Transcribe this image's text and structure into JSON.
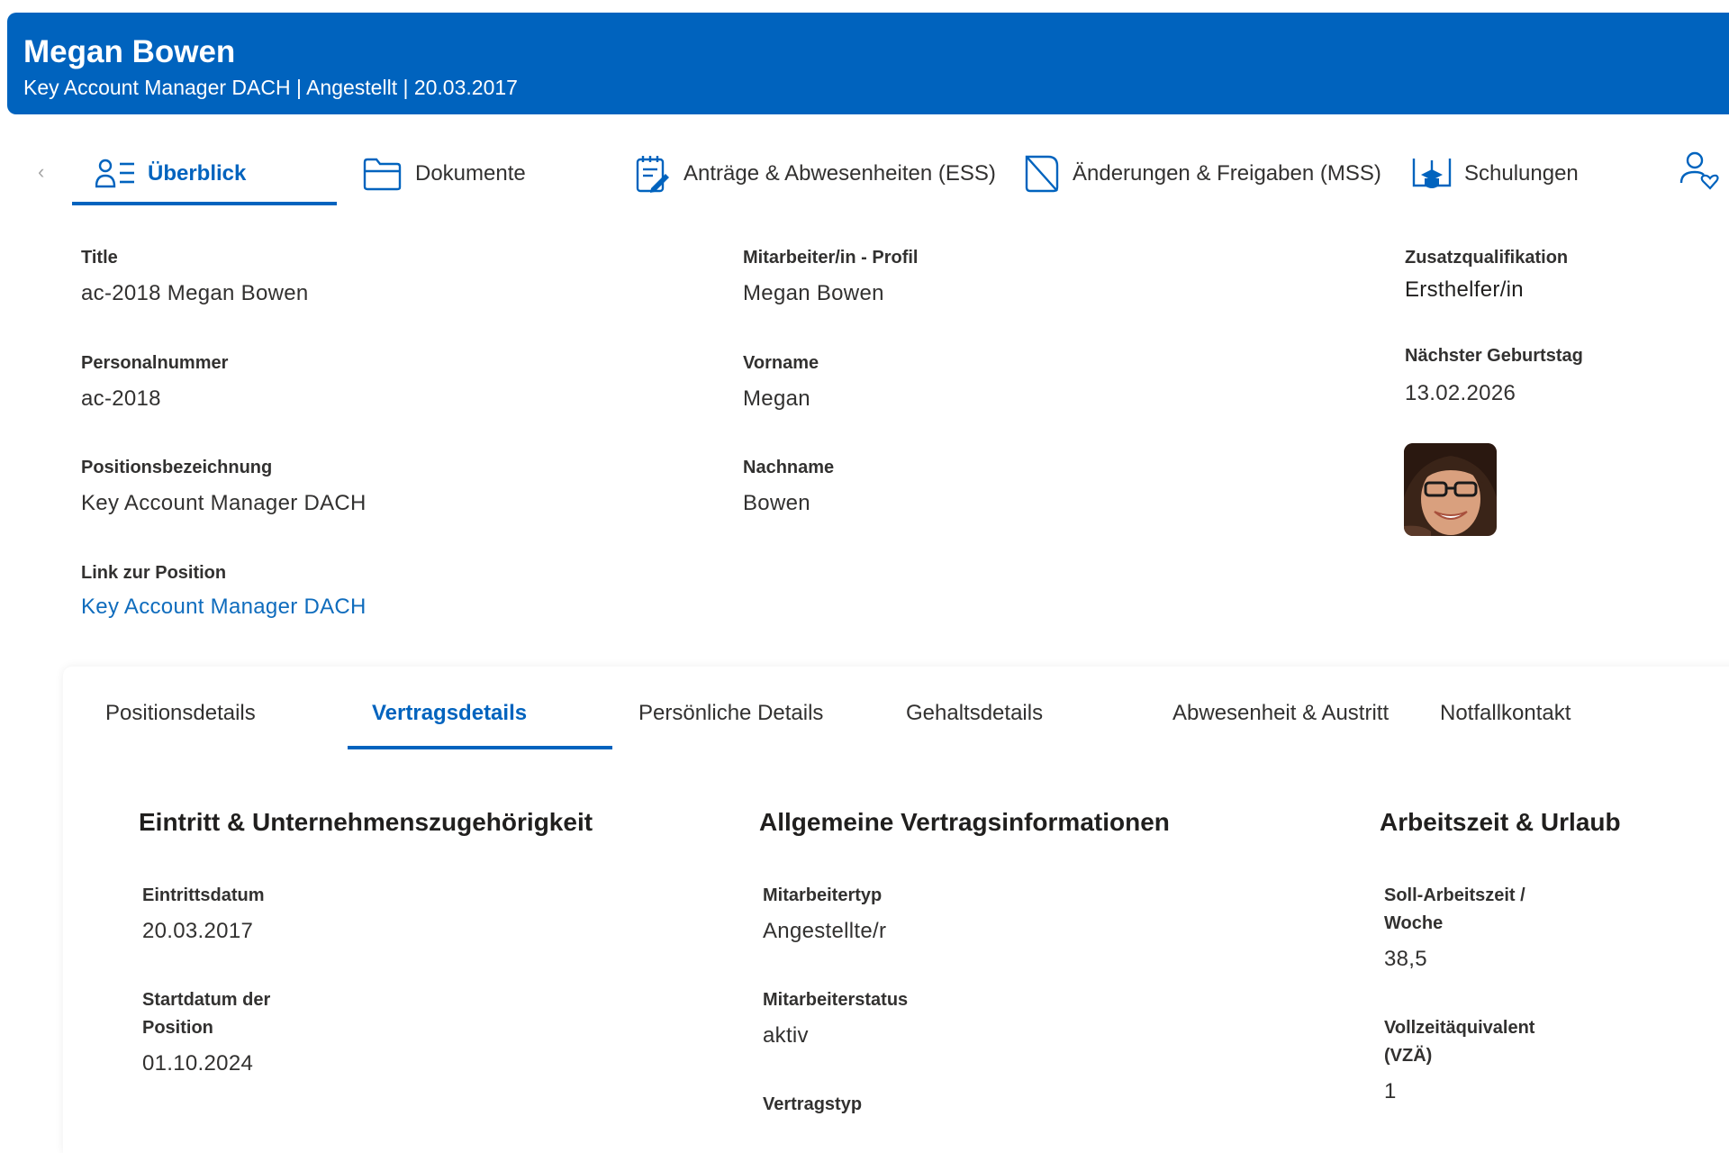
{
  "header": {
    "name": "Megan Bowen",
    "subtitle": "Key Account Manager DACH | Angestellt | 20.03.2017",
    "background": "#0063be"
  },
  "nav": {
    "tabs": [
      {
        "label": "Überblick",
        "icon": "people-list-icon",
        "active": true
      },
      {
        "label": "Dokumente",
        "icon": "folder-icon",
        "active": false
      },
      {
        "label": "Anträge & Abwesenheiten (ESS)",
        "icon": "notepad-edit-icon",
        "active": false
      },
      {
        "label": "Änderungen & Freigaben (MSS)",
        "icon": "document-fold-icon",
        "active": false
      },
      {
        "label": "Schulungen",
        "icon": "book-graduation-icon",
        "active": false
      }
    ],
    "scroll_left_icon": "chevron-left-icon",
    "extra_icon": "person-heart-icon",
    "accent": "#0063be"
  },
  "overview": {
    "title": {
      "label": "Title",
      "value": "ac-2018 Megan Bowen"
    },
    "personalnummer": {
      "label": "Personalnummer",
      "value": "ac-2018"
    },
    "positionsbezeichnung": {
      "label": "Positionsbezeichnung",
      "value": "Key Account Manager DACH"
    },
    "link_zur_position": {
      "label": "Link zur Position",
      "value": "Key Account Manager DACH"
    },
    "profil": {
      "label": "Mitarbeiter/in - Profil",
      "value": "Megan Bowen"
    },
    "vorname": {
      "label": "Vorname",
      "value": "Megan"
    },
    "nachname": {
      "label": "Nachname",
      "value": "Bowen"
    },
    "zusatzqualifikation": {
      "label": "Zusatzqualifikation",
      "value": "Ersthelfer/in"
    },
    "geburtstag": {
      "label": "Nächster Geburtstag",
      "value": "13.02.2026"
    }
  },
  "detail_tabs": [
    {
      "label": "Positionsdetails",
      "active": false
    },
    {
      "label": "Vertragsdetails",
      "active": true
    },
    {
      "label": "Persönliche Details",
      "active": false
    },
    {
      "label": "Gehaltsdetails",
      "active": false
    },
    {
      "label": "Abwesenheit & Austritt",
      "active": false
    },
    {
      "label": "Notfallkontakt",
      "active": false
    }
  ],
  "sections": {
    "eintritt": {
      "title": "Eintritt & Unternehmenszugehörigkeit",
      "eintrittsdatum": {
        "label": "Eintrittsdatum",
        "value": "20.03.2017"
      },
      "startdatum": {
        "label_line1": "Startdatum der",
        "label_line2": "Position",
        "value": "01.10.2024"
      }
    },
    "allgemein": {
      "title": "Allgemeine Vertragsinformationen",
      "mitarbeitertyp": {
        "label": "Mitarbeitertyp",
        "value": "Angestellte/r"
      },
      "mitarbeiterstatus": {
        "label": "Mitarbeiterstatus",
        "value": "aktiv"
      },
      "vertragstyp": {
        "label": "Vertragstyp"
      }
    },
    "arbeitszeit": {
      "title": "Arbeitszeit & Urlaub",
      "soll": {
        "label_line1": "Soll-Arbeitszeit /",
        "label_line2": "Woche",
        "value": "38,5"
      },
      "vzae": {
        "label_line1": "Vollzeitäquivalent",
        "label_line2": "(VZÄ)",
        "value": "1"
      }
    }
  }
}
